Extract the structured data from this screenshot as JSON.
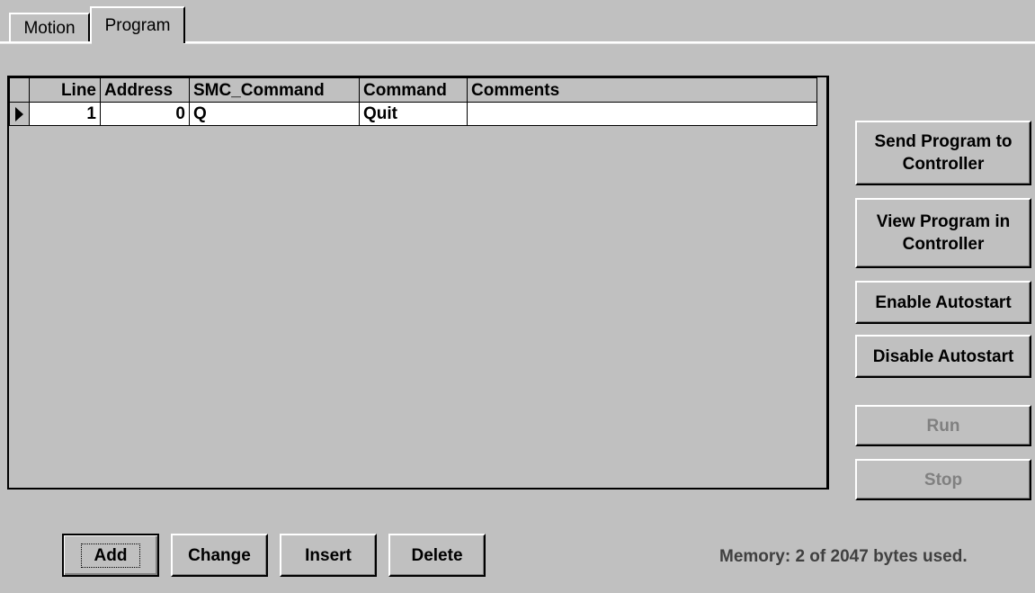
{
  "tabs": [
    {
      "label": "Motion",
      "active": false
    },
    {
      "label": "Program",
      "active": true
    }
  ],
  "grid": {
    "columns": [
      "Line",
      "Address",
      "SMC_Command",
      "Command",
      "Comments"
    ],
    "rows": [
      {
        "line": "1",
        "address": "0",
        "smc_command": "Q",
        "command": "Quit",
        "comments": ""
      }
    ]
  },
  "side_buttons": {
    "send_program": "Send Program to Controller",
    "view_program": "View Program in Controller",
    "enable_autostart": "Enable Autostart",
    "disable_autostart": "Disable Autostart",
    "run": "Run",
    "stop": "Stop"
  },
  "bottom_buttons": {
    "add": "Add",
    "change": "Change",
    "insert": "Insert",
    "delete": "Delete"
  },
  "status": {
    "memory": "Memory: 2 of 2047 bytes used."
  },
  "colors": {
    "face": "#c0c0c0",
    "disabled_text": "#808080"
  }
}
